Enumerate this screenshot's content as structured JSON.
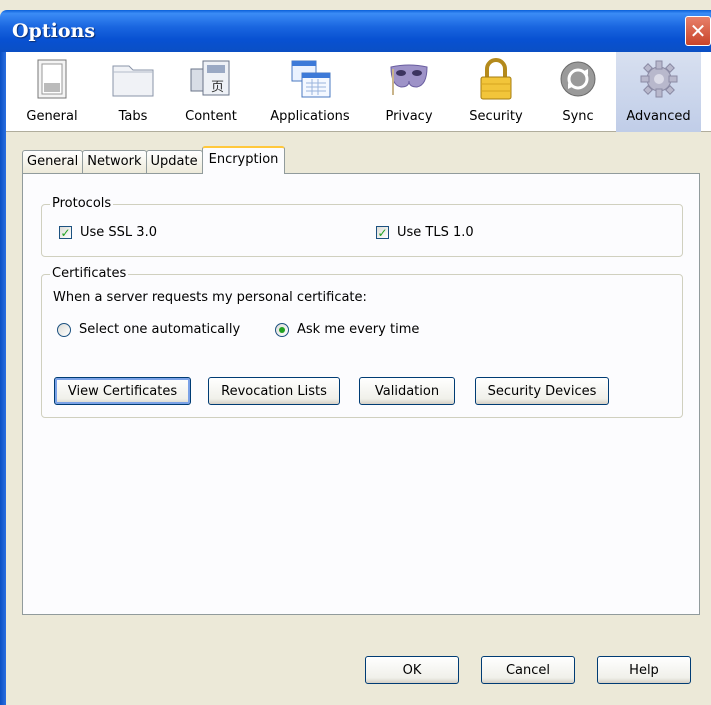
{
  "window": {
    "title": "Options"
  },
  "toolbar": {
    "items": [
      {
        "label": "General",
        "icon": "general-switch-icon"
      },
      {
        "label": "Tabs",
        "icon": "tabs-folder-icon"
      },
      {
        "label": "Content",
        "icon": "content-page-icon"
      },
      {
        "label": "Applications",
        "icon": "applications-icon"
      },
      {
        "label": "Privacy",
        "icon": "privacy-mask-icon"
      },
      {
        "label": "Security",
        "icon": "security-lock-icon"
      },
      {
        "label": "Sync",
        "icon": "sync-icon"
      },
      {
        "label": "Advanced",
        "icon": "advanced-gear-icon",
        "selected": true
      }
    ]
  },
  "tabs": {
    "items": [
      "General",
      "Network",
      "Update",
      "Encryption"
    ],
    "active": "Encryption"
  },
  "protocols": {
    "legend": "Protocols",
    "ssl_label": "Use SSL 3.0",
    "ssl_checked": true,
    "tls_label": "Use TLS 1.0",
    "tls_checked": true
  },
  "certificates": {
    "legend": "Certificates",
    "prompt": "When a server requests my personal certificate:",
    "radio_auto": "Select one automatically",
    "radio_ask": "Ask me every time",
    "selected": "ask",
    "buttons": {
      "view": "View Certificates",
      "revocation": "Revocation Lists",
      "validation": "Validation",
      "devices": "Security Devices"
    }
  },
  "footer": {
    "ok": "OK",
    "cancel": "Cancel",
    "help": "Help"
  },
  "colors": {
    "titlebar": "#0a5fd8",
    "dialog_bg": "#ece9d8",
    "check": "#21a121",
    "tab_highlight": "#ffc83c"
  }
}
